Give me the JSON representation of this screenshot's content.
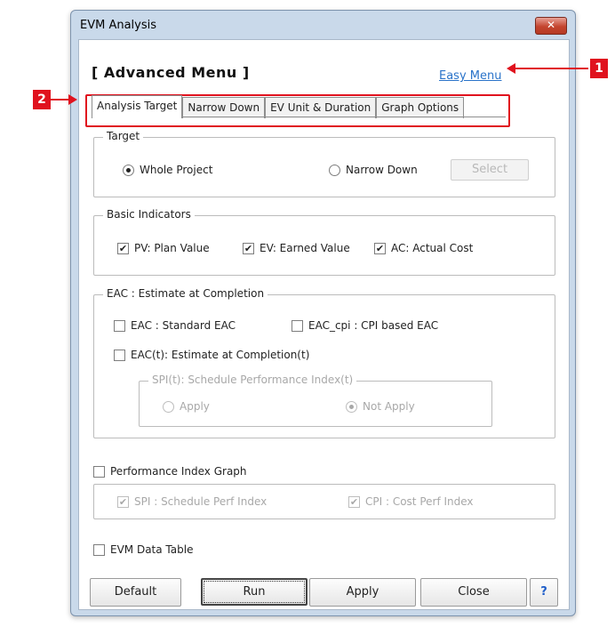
{
  "window": {
    "title": "EVM Analysis",
    "close_glyph": "✕"
  },
  "heading": "[ Advanced Menu ]",
  "easy_menu_link": "Easy Menu",
  "tabs": [
    {
      "label": "Analysis Target",
      "active": true
    },
    {
      "label": "Narrow Down",
      "active": false
    },
    {
      "label": "EV Unit & Duration",
      "active": false
    },
    {
      "label": "Graph Options",
      "active": false
    }
  ],
  "target": {
    "legend": "Target",
    "whole_project": {
      "label": "Whole Project",
      "selected": true
    },
    "narrow_down": {
      "label": "Narrow Down",
      "selected": false
    },
    "select_button": "Select"
  },
  "basic_indicators": {
    "legend": "Basic Indicators",
    "pv": {
      "label": "PV: Plan Value",
      "checked": true
    },
    "ev": {
      "label": "EV: Earned Value",
      "checked": true
    },
    "ac": {
      "label": "AC: Actual Cost",
      "checked": true
    }
  },
  "eac": {
    "legend": "EAC : Estimate at Completion",
    "standard": {
      "label": "EAC : Standard EAC",
      "checked": false
    },
    "cpi_based": {
      "label": "EAC_cpi : CPI based EAC",
      "checked": false
    },
    "eac_t": {
      "label": "EAC(t): Estimate at Completion(t)",
      "checked": false
    },
    "spi_t": {
      "legend": "SPI(t): Schedule Performance Index(t)",
      "apply": {
        "label": "Apply",
        "selected": false
      },
      "not_apply": {
        "label": "Not Apply",
        "selected": true
      }
    }
  },
  "performance_graph": {
    "label": "Performance Index Graph",
    "checked": false,
    "spi": {
      "label": "SPI : Schedule Perf Index",
      "checked": true
    },
    "cpi": {
      "label": "CPI : Cost Perf Index",
      "checked": true
    }
  },
  "evm_table": {
    "label": "EVM Data Table",
    "checked": false
  },
  "buttons": {
    "default": "Default",
    "run": "Run",
    "apply": "Apply",
    "close": "Close",
    "help": "?"
  },
  "annotations": {
    "marker1": "1",
    "marker2": "2"
  },
  "colors": {
    "annotation_red": "#e0121e",
    "link_blue": "#2a73c9"
  }
}
